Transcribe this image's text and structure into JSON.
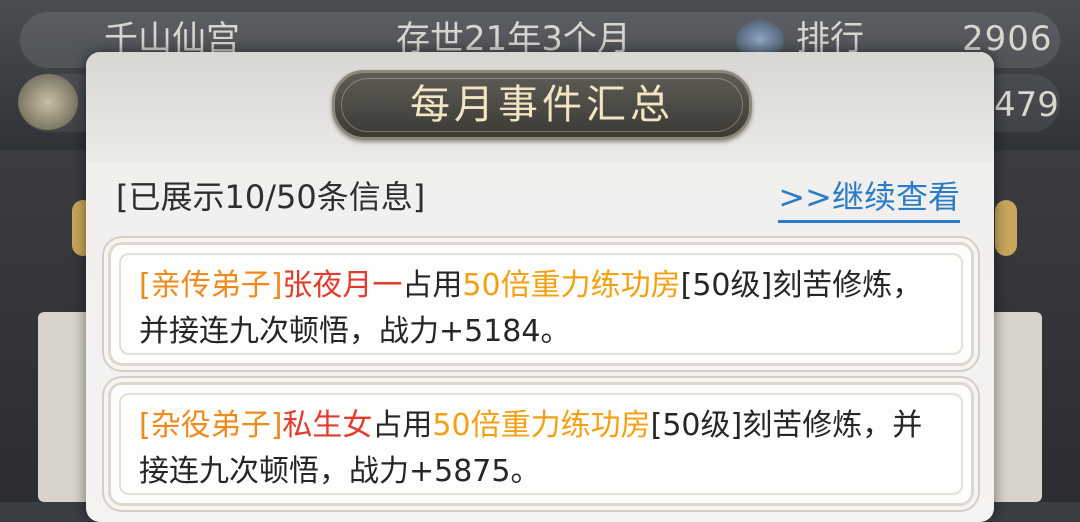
{
  "background": {
    "sect_name": "千山仙宫",
    "age": "存世21年3个月",
    "rank_label": "排行",
    "rank_value": "2906",
    "second_value": "479"
  },
  "modal": {
    "title": "每月事件汇总",
    "shown_info": "[已展示10/50条信息]",
    "continue_link": ">>继续查看"
  },
  "events": [
    {
      "role": "[亲传弟子]",
      "name": "张夜月一",
      "action": "占用",
      "room": "50倍重力练功房",
      "rest": "[50级]刻苦修炼，并接连九次顿悟，战力+5184。"
    },
    {
      "role": "[杂役弟子]",
      "name": "私生女",
      "action": "占用",
      "room": "50倍重力练功房",
      "rest": "[50级]刻苦修炼，并接连九次顿悟，战力+5875。"
    }
  ],
  "colors": {
    "role": "#f08a1c",
    "name": "#e33b2e",
    "room": "#f3a012",
    "link": "#2b7cc7"
  }
}
